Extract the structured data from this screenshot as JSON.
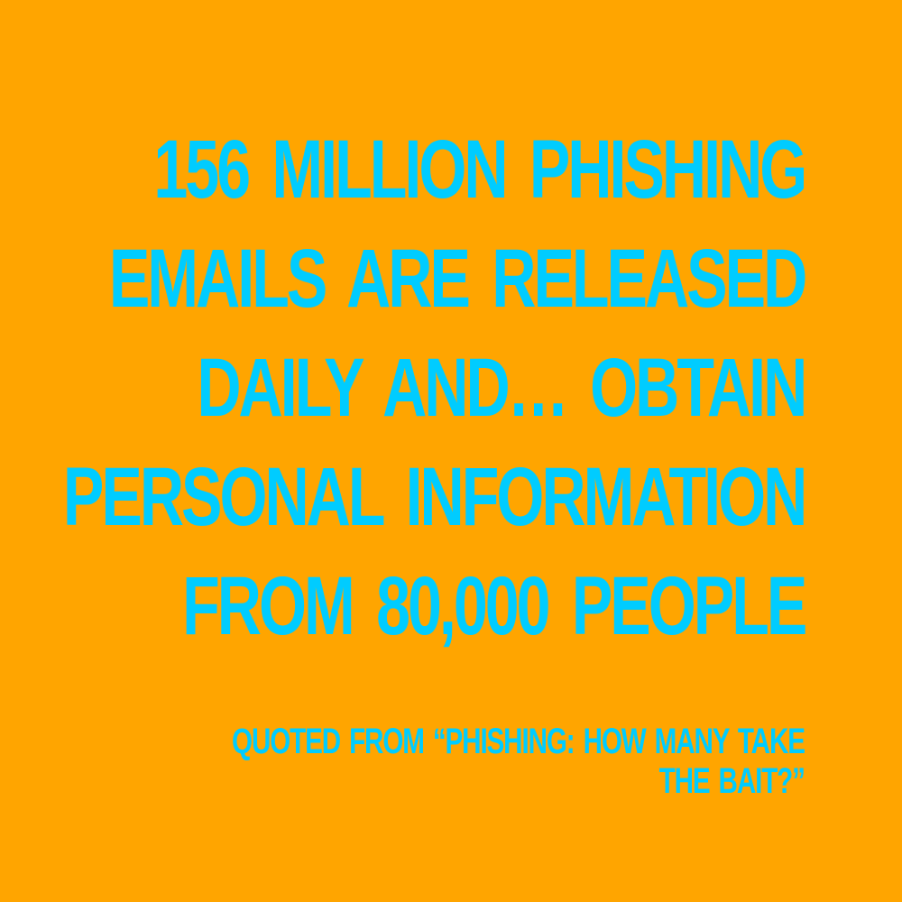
{
  "colors": {
    "background": "#FFA500",
    "text": "#00CCFF"
  },
  "quote": {
    "lines": [
      "156 MILLION PHISHING",
      "EMAILS ARE RELEASED",
      "DAILY AND… OBTAIN",
      "PERSONAL INFORMATION",
      "FROM 80,000 PEOPLE"
    ]
  },
  "attribution": {
    "lines": [
      "QUOTED FROM “PHISHING: HOW MANY TAKE",
      "THE BAIT?”"
    ]
  }
}
